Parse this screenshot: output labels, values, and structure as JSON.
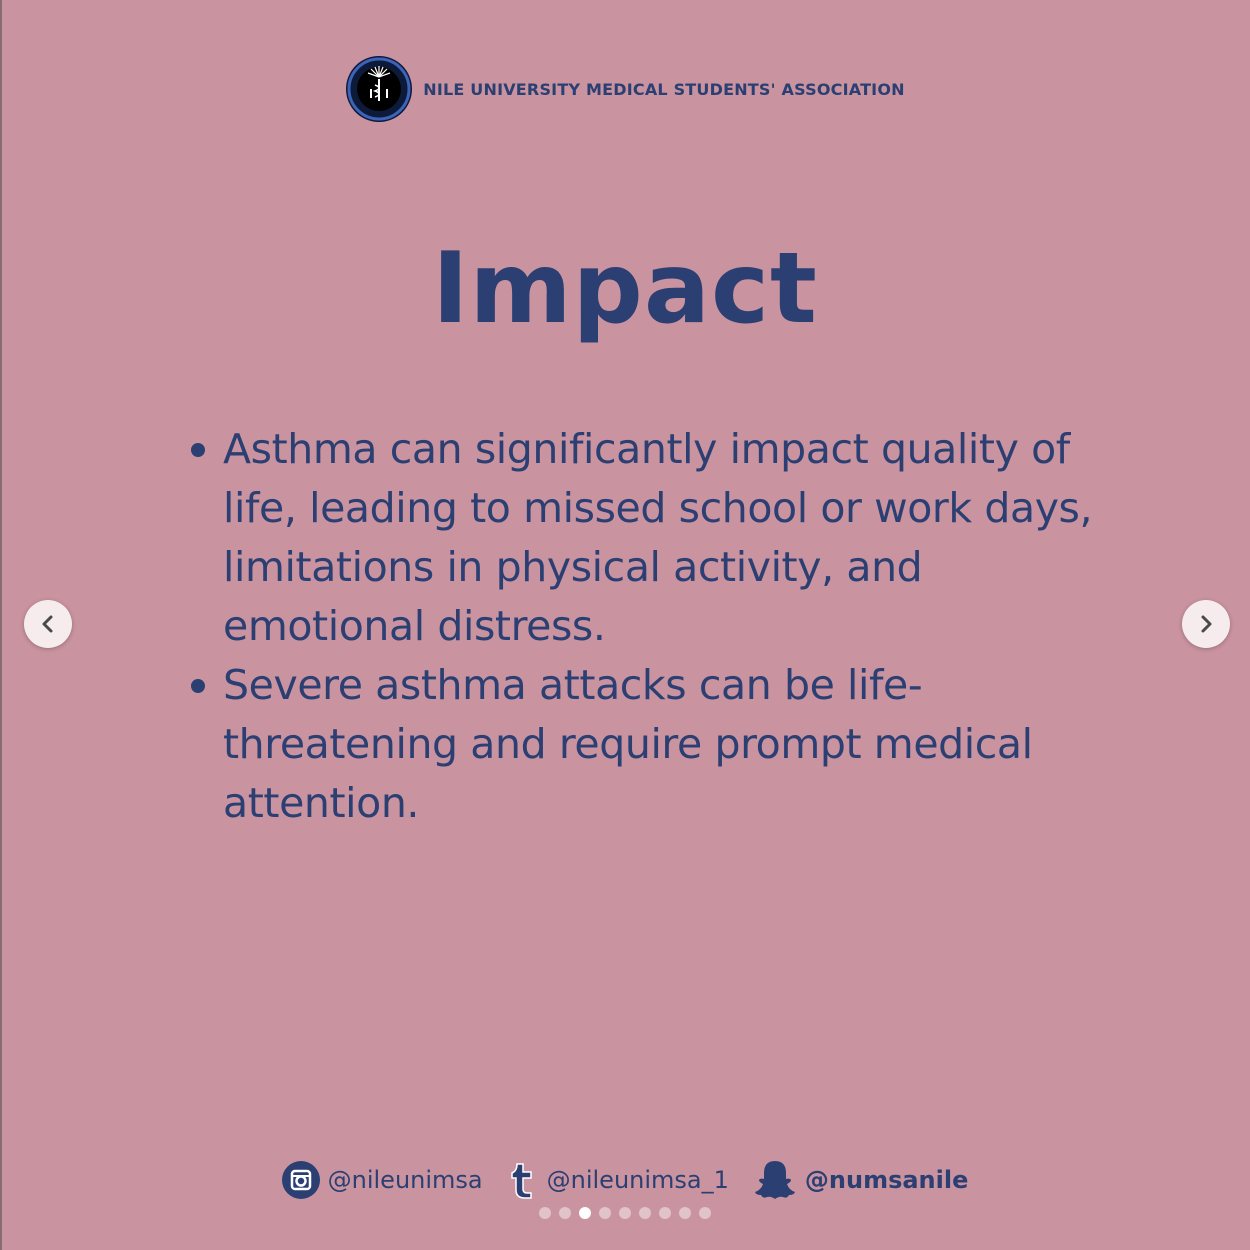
{
  "header": {
    "org_name": "NILE UNIVERSITY MEDICAL STUDENTS' ASSOCIATION",
    "logo_icon": "numsa-logo"
  },
  "slide": {
    "title": "Impact",
    "bullets": [
      "Asthma can significantly impact quality of life, leading to missed school or work days, limitations in physical activity, and emotional distress.",
      "Severe asthma attacks can be life-threatening and require prompt medical attention."
    ]
  },
  "footer": {
    "socials": [
      {
        "icon": "instagram-icon",
        "handle": "@nileunimsa"
      },
      {
        "icon": "tumblr-icon",
        "handle": "@nileunimsa_1"
      },
      {
        "icon": "snapchat-icon",
        "handle": "@numsanile"
      }
    ]
  },
  "carousel": {
    "total_slides": 9,
    "active_index": 2,
    "prev_icon": "chevron-left-icon",
    "next_icon": "chevron-right-icon"
  },
  "colors": {
    "background": "#c9939f",
    "text": "#2b3f73",
    "nav_button": "#f6ecee"
  }
}
